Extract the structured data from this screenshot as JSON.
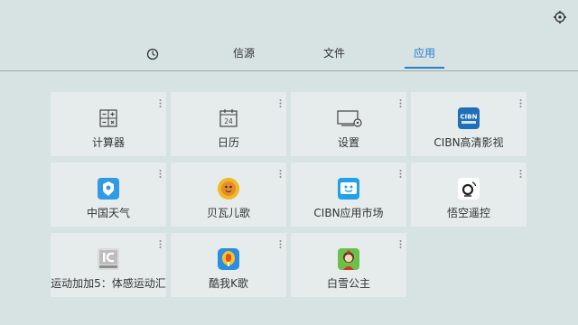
{
  "header": {
    "settings_icon": "gear-icon"
  },
  "tabs": [
    {
      "label": "",
      "icon": "clock-icon"
    },
    {
      "label": "信源"
    },
    {
      "label": "文件"
    },
    {
      "label": "应用",
      "active": true
    }
  ],
  "colors": {
    "accent": "#2a7fc8",
    "background": "#d7e2e2",
    "tile": "#e6ecec"
  },
  "apps": [
    {
      "label": "计算器",
      "icon": "calculator-icon"
    },
    {
      "label": "日历",
      "icon": "calendar-icon",
      "icon_text": "24"
    },
    {
      "label": "设置",
      "icon": "tv-settings-icon"
    },
    {
      "label": "CIBN高清影视",
      "icon": "cibn-video-icon",
      "icon_text": "CIBN"
    },
    {
      "label": "中国天气",
      "icon": "china-weather-icon"
    },
    {
      "label": "贝瓦儿歌",
      "icon": "beva-songs-icon"
    },
    {
      "label": "CIBN应用市场",
      "icon": "app-market-icon"
    },
    {
      "label": "悟空遥控",
      "icon": "wukong-remote-icon"
    },
    {
      "label": "运动加加5：体感运动汇",
      "icon": "sport-plus-icon"
    },
    {
      "label": "酷我K歌",
      "icon": "kuwo-karaoke-icon"
    },
    {
      "label": "白雪公主",
      "icon": "snow-white-icon"
    }
  ]
}
